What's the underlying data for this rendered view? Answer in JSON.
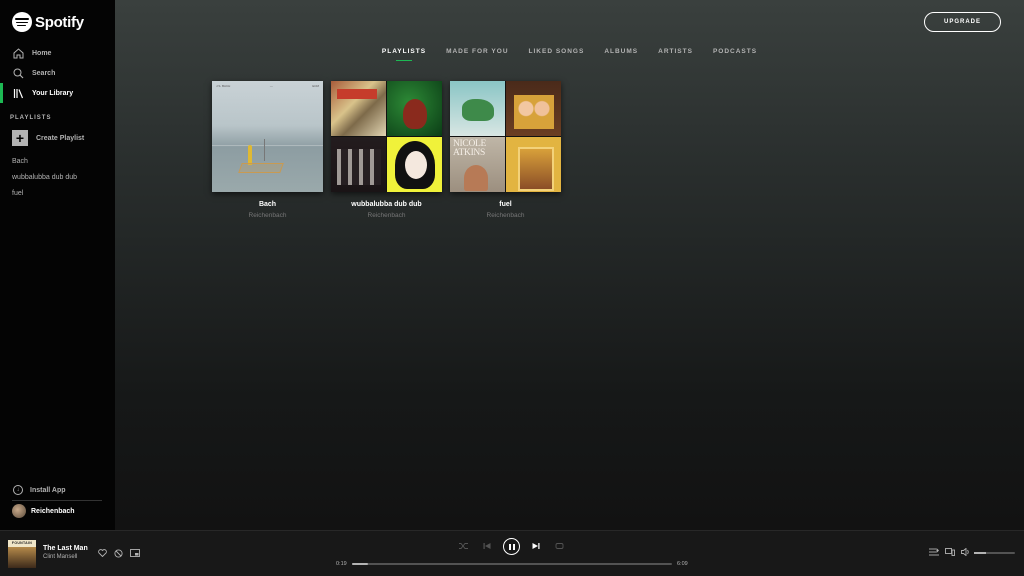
{
  "app": {
    "brand": "Spotify",
    "accent": "#1db954"
  },
  "sidebar": {
    "nav": [
      {
        "label": "Home",
        "icon": "home-icon"
      },
      {
        "label": "Search",
        "icon": "search-icon"
      },
      {
        "label": "Your Library",
        "icon": "library-icon",
        "active": true
      }
    ],
    "playlists_label": "PLAYLISTS",
    "create_playlist": "Create Playlist",
    "playlists": [
      "Bach",
      "wubbalubba dub dub",
      "fuel"
    ],
    "install_app": "Install App",
    "user_name": "Reichenbach"
  },
  "header": {
    "upgrade_label": "UPGRADE"
  },
  "tabs": [
    {
      "label": "PLAYLISTS",
      "active": true
    },
    {
      "label": "MADE FOR YOU"
    },
    {
      "label": "LIKED SONGS"
    },
    {
      "label": "ALBUMS"
    },
    {
      "label": "ARTISTS"
    },
    {
      "label": "PODCASTS"
    }
  ],
  "cards": [
    {
      "title": "Bach",
      "owner": "Reichenbach"
    },
    {
      "title": "wubbalubba dub dub",
      "owner": "Reichenbach"
    },
    {
      "title": "fuel",
      "owner": "Reichenbach",
      "cover_text": "NICOLE ATKINS"
    }
  ],
  "player": {
    "art_text": "FOUNTAIN",
    "title": "The Last Man",
    "artist": "Clint Mansell",
    "elapsed": "0:19",
    "duration": "6:09",
    "progress_fraction": 0.05,
    "volume_fraction": 0.3
  }
}
